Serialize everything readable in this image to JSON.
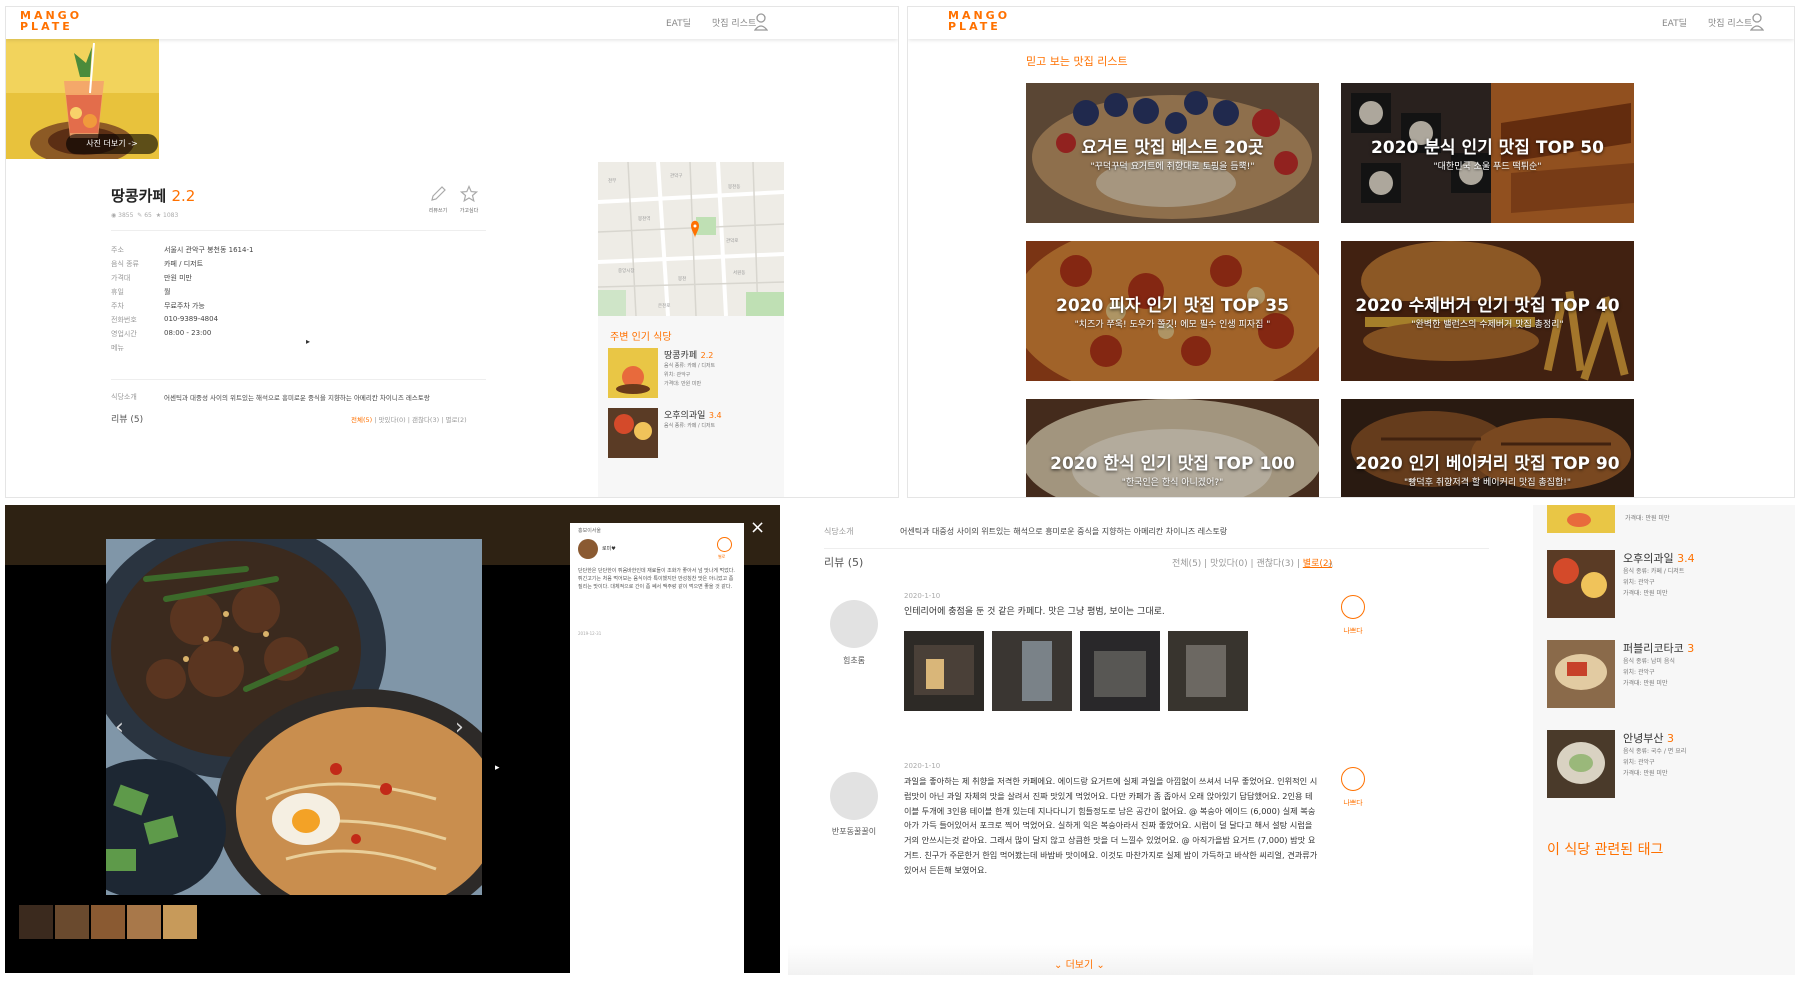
{
  "brand": {
    "logo_line1": "MANGO",
    "logo_line2": "PLATE"
  },
  "nav": {
    "eat": "EAT딜",
    "list": "맛집 리스트"
  },
  "detail": {
    "photo_more": "사진 더보기 ->",
    "name": "땅콩카페",
    "rating": "2.2",
    "write_review": "리뷰쓰기",
    "want_to_go": "가고싶다",
    "stats": {
      "views": "3855",
      "reviews": "65",
      "stars": "1083"
    },
    "info": [
      {
        "key": "주소",
        "value": "서울시 관악구 봉천동 1614-1"
      },
      {
        "key": "음식 종류",
        "value": "카페 / 디저트"
      },
      {
        "key": "가격대",
        "value": "만원 미만"
      },
      {
        "key": "휴일",
        "value": "월"
      },
      {
        "key": "주차",
        "value": "무료주차 가능"
      },
      {
        "key": "전화번호",
        "value": "010-9389-4804"
      },
      {
        "key": "영업시간",
        "value": "08:00 - 23:00"
      },
      {
        "key": "메뉴",
        "value": ""
      }
    ],
    "intro_label": "식당소개",
    "intro_text": "어센틱과 대중성 사이의 위트있는 해석으로 흥미로운 중식을 지향하는 아메리칸 차이니즈 레스토랑",
    "review_header": "리뷰 (5)",
    "filters": [
      "전체(5)",
      "맛있다(0)",
      "괜찮다(3)",
      "별로(2)"
    ]
  },
  "nearby": {
    "title": "주변 인기 식당",
    "items": [
      {
        "name": "땅콩카페",
        "rating": "2.2",
        "food": "음식 종류: 카페 / 디저트",
        "area": "위치: 관악구",
        "price": "가격대: 만원 미만"
      },
      {
        "name": "오후의과일",
        "rating": "3.4",
        "food": "음식 종류: 카페 / 디저트",
        "area": "위치: 관악구",
        "price": "가격대: 만원 미만"
      }
    ]
  },
  "lists": {
    "section_title": "믿고 보는 맛집 리스트",
    "tiles": [
      {
        "title": "요거트 맛집 베스트 20곳",
        "sub": "\"꾸덕꾸덕 요거트에 취향대로 토핑을 듬뿍!\""
      },
      {
        "title": "2020 분식 인기 맛집 TOP 50",
        "sub": "\"대한민국 소울 푸드 떡튀순\""
      },
      {
        "title": "2020 피자 인기 맛집 TOP 35",
        "sub": "\"치즈가 쭈욱! 도우가 쫄깃! 에모 필수 인생 피자집 \""
      },
      {
        "title": "2020 수제버거 인기 맛집 TOP 40",
        "sub": "\"완벽한 밸런스의 수제버거 맛집 총정리\""
      },
      {
        "title": "2020 한식 인기 맛집 TOP 100",
        "sub": "\"한국인은 한식 아니겠어?\""
      },
      {
        "title": "2020 인기 베이커리 맛집 TOP 90",
        "sub": "\"빵덕후 취향저격 할 베이커리 맛집 총집합!\""
      }
    ]
  },
  "lightbox": {
    "place": "홍보이서울",
    "user": "로미♥",
    "verdict": "별로",
    "text": "단단한은 단단한이 튀음바한인데 재료들이 조화가 좋아서 넘 맛나게 먹었다. 튀긴고기는 처음 먹어보는 음식이라 특이했지만 만성칭찬 맛은 아니었고 좀 질리는 맛이다. 대체적으로 간이 좀 쎄서 맥주랑 같이 먹으면 좋을 것 같다.",
    "date": "2019-12-31",
    "close": "×"
  },
  "reviews": {
    "intro_label": "식당소개",
    "intro_text": "어센틱과 대중성 사이의 위트있는 해석으로 흥미로운 중식을 지향하는 아메리칸 차이니즈 레스토랑",
    "header": "리뷰 (5)",
    "filters": [
      "전체(5)",
      "맛있다(0)",
      "괜찮다(3)",
      "별로(2)"
    ],
    "items": [
      {
        "user": "힘초롬",
        "date": "2020-1-10",
        "text": "인테리어에 충점을 둔 것 같은 카페다. 맛은 그냥 평범, 보이는 그대로.",
        "verdict": "나쁘다"
      },
      {
        "user": "반포동꿀꿀이",
        "date": "2020-1-10",
        "text": "과일을 좋아하는 제 취향을 저격한 카페에요. 에이드랑 요거트에 실제 과일을 아낌없이 쓰셔서 너무 좋었어요. 인위적인 시럽맛이 아닌 과일 자체의 맛을 살려서 진짜 맛있게 먹었어요. 다만 카페가 좀 좁아서 오래 앉아있기 답답했어요. 2인용 테이블 두개에 3인용 테이블 한개 있는데 지나다니기 힘들정도로 남은 공간이 없어요. @ 복숭아 에이드 (6,000) 실제 복숭아가 가득 들어있어서 포크로 찍어 먹었어요. 실하게 익은 복숭아라서 진짜 좋았어요. 시럽이 덜 달다고 해서 설탕 시럽을 거의 안쓰시는것 같아요. 그래서 많이 달지 않고 상큼한 맛을 더 느낄수 있었어요. @ 아직가을밤 요거트 (7,000) 밤맛 요거트. 친구가 주문한거 한입 먹어봤는데 바밤바 맛이에요. 이것도 마찬가지로 실제 밤이 가득하고 바삭한 씨리얼, 견과류가 있어서 든든해 보였어요.",
        "verdict": "나쁘다"
      }
    ],
    "more": "더보기"
  },
  "side": {
    "items": [
      {
        "name": "오후의과일",
        "rating": "3.4",
        "food": "음식 종류: 카페 / 디저트",
        "area": "위치: 관악구",
        "price": "가격대: 만원 미만"
      },
      {
        "name": "퍼블리코타코",
        "rating": "3",
        "food": "음식 종류: 남미 음식",
        "area": "위치: 관악구",
        "price": "가격대: 만원 미만"
      },
      {
        "name": "안녕부산",
        "rating": "3",
        "food": "음식 종류: 국수 / 면 요리",
        "area": "위치: 관악구",
        "price": "가격대: 만원 미만"
      }
    ],
    "top_price": "가격대: 만원 미만",
    "tags_title": "이 식당 관련된 태그"
  }
}
